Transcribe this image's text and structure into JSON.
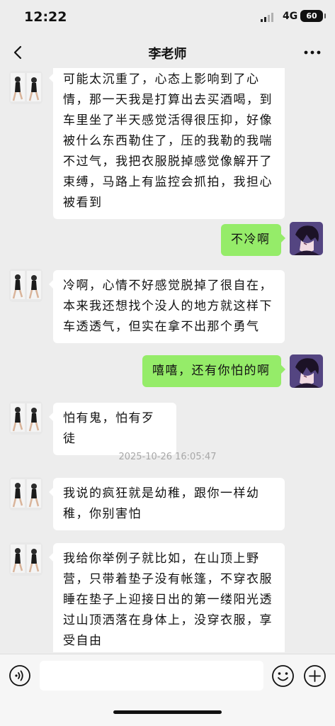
{
  "status": {
    "time": "12:22",
    "network": "4G",
    "battery": "60"
  },
  "nav": {
    "title": "李老师",
    "back_icon": "chevron-left-icon",
    "more_icon": "more-dots-icon"
  },
  "messages": [
    {
      "from": "other",
      "lines": [
        "可能太沉重了，心态上影响到了心",
        "情，那一天我是打算出去买酒喝，到",
        "车里坐了半天感觉活得很压抑，好像",
        "被什么东西勒住了，压的我勒的我喘",
        "不过气，我把衣服脱掉感觉像解开了",
        "束缚，马路上有监控会抓拍，我担心",
        "被看到"
      ]
    },
    {
      "from": "me",
      "lines": [
        "不冷啊"
      ]
    },
    {
      "from": "other",
      "lines": [
        "冷啊，心情不好感觉脱掉了很自在，",
        "本来我还想找个没人的地方就这样下",
        "车透透气，但实在拿不出那个勇气"
      ]
    },
    {
      "from": "me",
      "lines": [
        "嘻嘻，还有你怕的啊"
      ]
    },
    {
      "from": "other",
      "lines": [
        "怕有鬼，怕有歹徒"
      ]
    },
    {
      "from": "other",
      "lines": [
        "我说的疯狂就是幼稚，跟你一样幼",
        "稚，你别害怕"
      ]
    },
    {
      "from": "other",
      "lines": [
        "我给你举例子就比如，在山顶上野",
        "营，只带着垫子没有帐篷，不穿衣服",
        "睡在垫子上迎接日出的第一缕阳光透",
        "过山顶洒落在身体上，没穿衣服，享",
        "受自由"
      ]
    }
  ],
  "timestamp": "2025-10-26 16:05:47",
  "input": {
    "value": "",
    "placeholder": ""
  },
  "icons": {
    "voice": "voice-icon",
    "emoji": "emoji-icon",
    "plus": "plus-icon"
  },
  "colors": {
    "background": "#ededed",
    "bubble_me": "#95ec69",
    "bubble_other": "#ffffff"
  }
}
